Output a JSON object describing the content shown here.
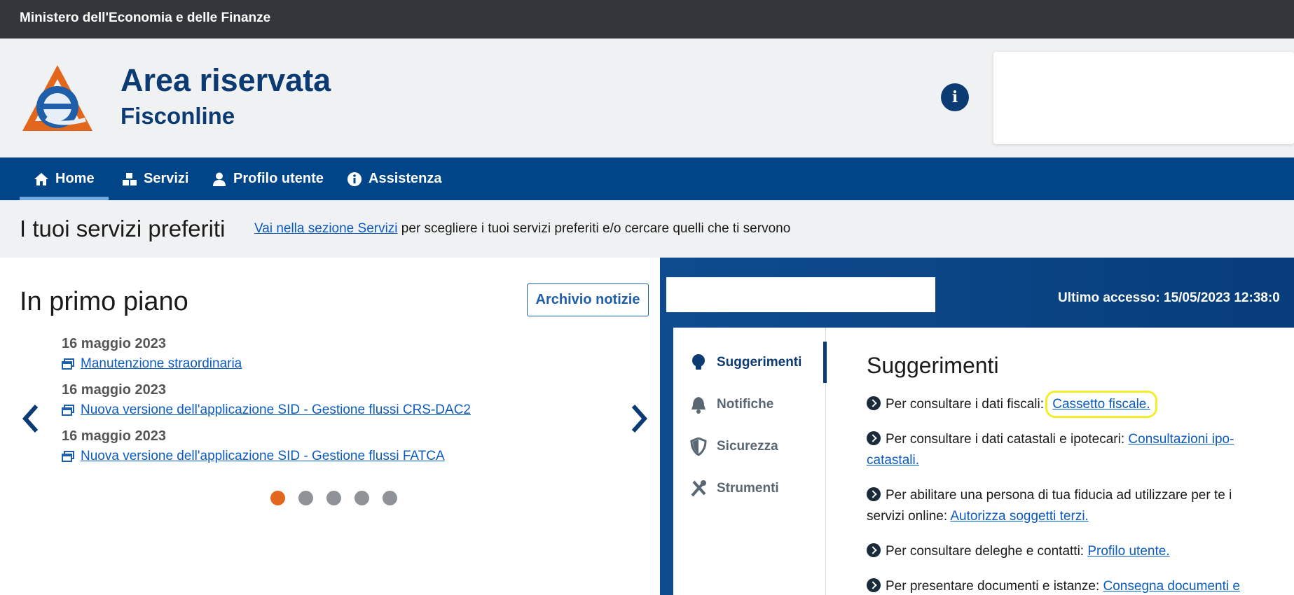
{
  "topbar": {
    "ministry": "Ministero dell'Economia e delle Finanze"
  },
  "header": {
    "title": "Area riservata",
    "subtitle": "Fisconline",
    "info_icon": "info-icon"
  },
  "nav": {
    "items": [
      {
        "label": "Home",
        "icon": "home-icon",
        "active": true
      },
      {
        "label": "Servizi",
        "icon": "cubes-icon"
      },
      {
        "label": "Profilo utente",
        "icon": "user-icon"
      },
      {
        "label": "Assistenza",
        "icon": "info-icon"
      }
    ]
  },
  "favorites": {
    "title": "I tuoi servizi preferiti",
    "link": "Vai nella sezione Servizi",
    "text": " per scegliere i tuoi servizi preferiti e/o cercare quelli che ti servono"
  },
  "news": {
    "title": "In primo piano",
    "archive_button": "Archivio notizie",
    "items": [
      {
        "date": "16 maggio 2023",
        "title": "Manutenzione straordinaria"
      },
      {
        "date": "16 maggio 2023",
        "title": "Nuova versione dell'applicazione SID - Gestione flussi CRS-DAC2"
      },
      {
        "date": "16 maggio 2023",
        "title": "Nuova versione dell'applicazione SID - Gestione flussi FATCA"
      }
    ],
    "pages": 5,
    "current_page": 1
  },
  "account": {
    "last_access": "Ultimo accesso: 15/05/2023 12:38:0"
  },
  "side_menu": {
    "items": [
      {
        "label": "Suggerimenti",
        "icon": "lightbulb-icon",
        "active": true
      },
      {
        "label": "Notifiche",
        "icon": "bell-icon"
      },
      {
        "label": "Sicurezza",
        "icon": "shield-icon"
      },
      {
        "label": "Strumenti",
        "icon": "tools-icon"
      }
    ]
  },
  "suggestions": {
    "title": "Suggerimenti",
    "items": [
      {
        "text": "Per consultare i dati fiscali: ",
        "link": "Cassetto fiscale.",
        "highlighted": true
      },
      {
        "text": "Per consultare i dati catastali e ipotecari: ",
        "link": "Consultazioni ipo-catastali."
      },
      {
        "text": "Per abilitare una persona di tua fiducia ad utilizzare per te i servizi online: ",
        "link": "Autorizza soggetti terzi."
      },
      {
        "text": "Per consultare deleghe e contatti: ",
        "link": "Profilo utente."
      },
      {
        "text": "Per presentare documenti e istanze: ",
        "link": "Consegna documenti e"
      }
    ]
  },
  "colors": {
    "brand_blue": "#004587",
    "accent_orange": "#e3661d",
    "link": "#0b5bc0",
    "highlight": "#f3ee2a"
  }
}
